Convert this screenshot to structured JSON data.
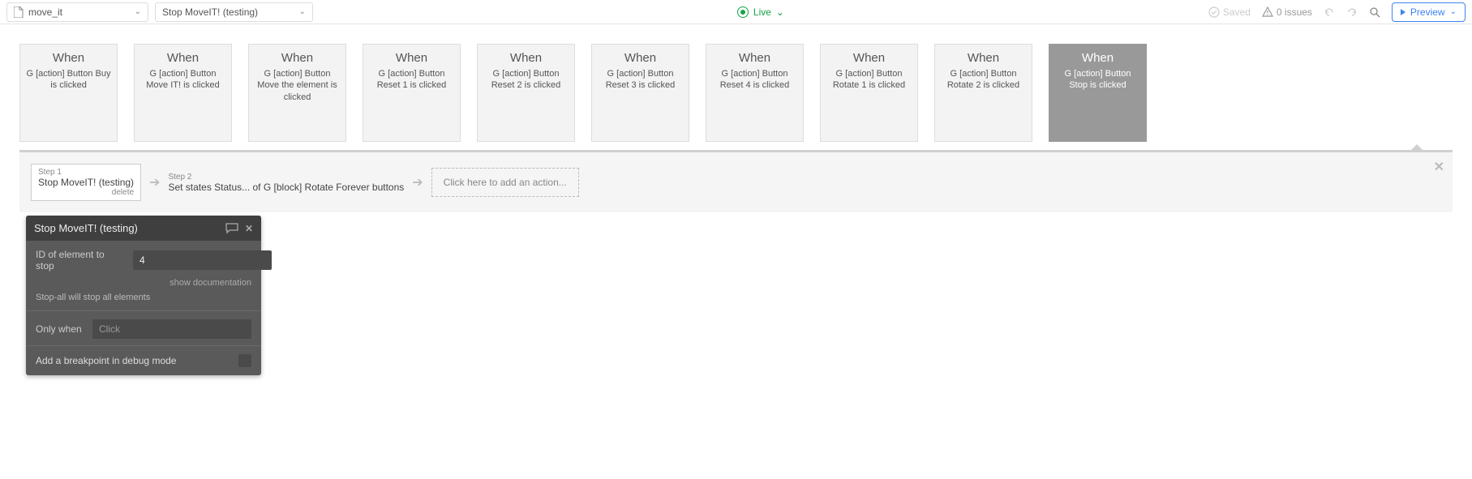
{
  "topbar": {
    "page_name": "move_it",
    "workflow_name": "Stop MoveIT! (testing)",
    "live_label": "Live",
    "saved_label": "Saved",
    "issues_label": "0 issues",
    "preview_label": "Preview"
  },
  "cards": [
    {
      "when": "When",
      "desc": "G [action] Button Buy is clicked",
      "active": false
    },
    {
      "when": "When",
      "desc": "G [action] Button Move IT! is clicked",
      "active": false
    },
    {
      "when": "When",
      "desc": "G [action] Button Move the element is clicked",
      "active": false
    },
    {
      "when": "When",
      "desc": "G [action] Button Reset 1 is clicked",
      "active": false
    },
    {
      "when": "When",
      "desc": "G [action] Button Reset 2 is clicked",
      "active": false
    },
    {
      "when": "When",
      "desc": "G [action] Button Reset 3 is clicked",
      "active": false
    },
    {
      "when": "When",
      "desc": "G [action] Button Reset 4 is clicked",
      "active": false
    },
    {
      "when": "When",
      "desc": "G [action] Button Rotate 1 is clicked",
      "active": false
    },
    {
      "when": "When",
      "desc": "G [action] Button Rotate 2 is clicked",
      "active": false
    },
    {
      "when": "When",
      "desc": "G [action] Button Stop is clicked",
      "active": true
    }
  ],
  "steps": {
    "step1_label": "Step 1",
    "step1_body": "Stop MoveIT! (testing)",
    "step1_delete": "delete",
    "step2_label": "Step 2",
    "step2_body": "Set states Status... of G [block] Rotate Forever buttons",
    "add_label": "Click here to add an action..."
  },
  "panel": {
    "title": "Stop MoveIT! (testing)",
    "field1_label": "ID of element to stop",
    "field1_value": "4",
    "doc_link": "show documentation",
    "note": "Stop-all will stop all elements",
    "only_when_label": "Only when",
    "only_when_placeholder": "Click",
    "breakpoint_label": "Add a breakpoint in debug mode"
  }
}
